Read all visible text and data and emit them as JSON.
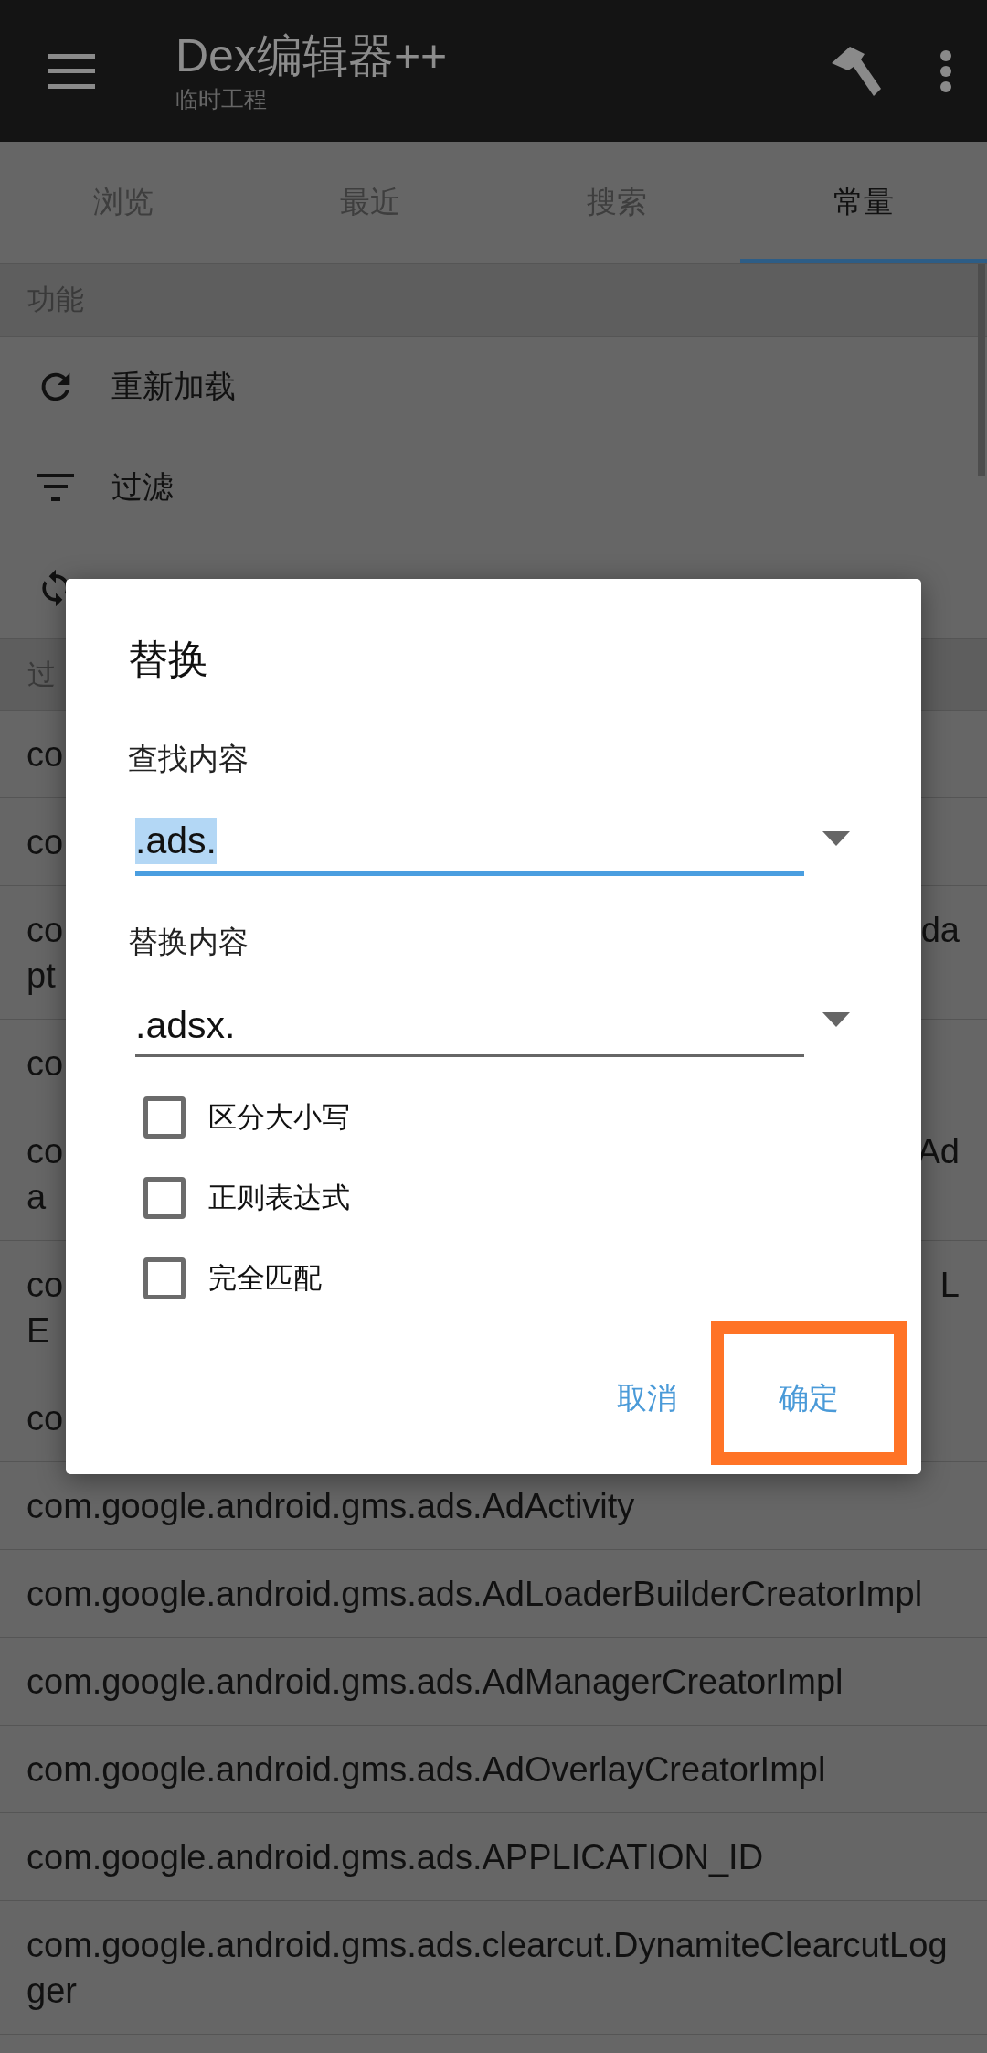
{
  "app_bar": {
    "title": "Dex编辑器++",
    "subtitle": "临时工程"
  },
  "tabs": [
    {
      "label": "浏览",
      "selected": false
    },
    {
      "label": "最近",
      "selected": false
    },
    {
      "label": "搜索",
      "selected": false
    },
    {
      "label": "常量",
      "selected": true
    }
  ],
  "function_section": {
    "header": "功能",
    "items": [
      {
        "kind": "reload",
        "label": "重新加载"
      },
      {
        "kind": "filter",
        "label": "过滤"
      },
      {
        "kind": "replace"
      }
    ]
  },
  "filter_section": {
    "header": "过"
  },
  "constants": [
    {
      "kind": "covered",
      "left_lines": [
        "co"
      ]
    },
    {
      "kind": "covered",
      "left_lines": [
        "co"
      ]
    },
    {
      "kind": "covered",
      "left_lines": [
        "co",
        "pt"
      ],
      "right_lines": [
        "da"
      ]
    },
    {
      "kind": "covered",
      "left_lines": [
        "co"
      ]
    },
    {
      "kind": "covered",
      "left_lines": [
        "co",
        "a"
      ],
      "right_lines": [
        "Ad"
      ]
    },
    {
      "kind": "covered",
      "left_lines": [
        "co",
        "E"
      ],
      "right_lines": [
        "L"
      ]
    },
    {
      "kind": "covered",
      "left_lines": [
        "co"
      ]
    },
    {
      "kind": "full",
      "text": "com.google.android.gms.ads.AdActivity"
    },
    {
      "kind": "full",
      "text": "com.google.android.gms.ads.AdLoaderBuilderCreatorImpl"
    },
    {
      "kind": "full",
      "text": "com.google.android.gms.ads.AdManagerCreatorImpl"
    },
    {
      "kind": "full",
      "text": "com.google.android.gms.ads.AdOverlayCreatorImpl"
    },
    {
      "kind": "full",
      "text": "com.google.android.gms.ads.APPLICATION_ID"
    },
    {
      "kind": "full",
      "text": "com.google.android.gms.ads.clearcut.DynamiteClearcutLogger"
    }
  ],
  "dialog": {
    "title": "替换",
    "fields": [
      {
        "label": "查找内容",
        "value": ".ads.",
        "focused": true,
        "text_selected": true
      },
      {
        "label": "替换内容",
        "value": ".adsx.",
        "focused": false,
        "text_selected": false
      }
    ],
    "options": [
      {
        "label": "区分大小写",
        "checked": false
      },
      {
        "label": "正则表达式",
        "checked": false
      },
      {
        "label": "完全匹配",
        "checked": false
      }
    ],
    "buttons": [
      {
        "label": "取消",
        "highlighted": false
      },
      {
        "label": "确定",
        "highlighted": true
      }
    ]
  }
}
